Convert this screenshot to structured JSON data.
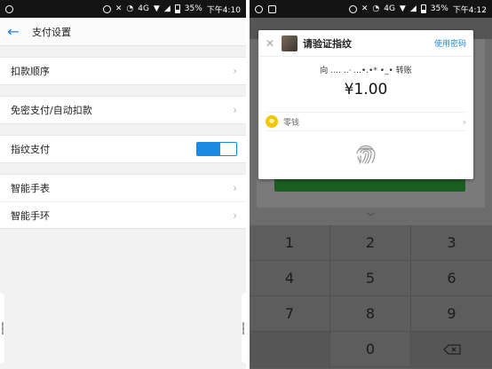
{
  "left": {
    "status": {
      "battery": "35%",
      "time": "下午4:10",
      "network": "4G"
    },
    "header": {
      "title": "支付设置"
    },
    "rows": {
      "deduct_order": "扣款顺序",
      "password_free": "免密支付/自动扣款",
      "fingerprint": "指纹支付",
      "smart_watch": "智能手表",
      "smart_band": "智能手环"
    },
    "fingerprint_toggle": {
      "on": true
    }
  },
  "right": {
    "status": {
      "battery": "35%",
      "time": "下午4:12",
      "network": "4G"
    },
    "dialog": {
      "title": "请验证指纹",
      "use_password": "使用密码",
      "recipient_prefix": "向",
      "recipient_masked": "…. ..·  ...•.•*  •_•",
      "recipient_suffix": "转账",
      "amount": "¥1.00",
      "payment_method": "零钱"
    },
    "keypad": {
      "keys": [
        "1",
        "2",
        "3",
        "4",
        "5",
        "6",
        "7",
        "8",
        "9",
        "0"
      ]
    }
  },
  "colors": {
    "accent": "#1e88e5",
    "coin": "#f6c500"
  }
}
